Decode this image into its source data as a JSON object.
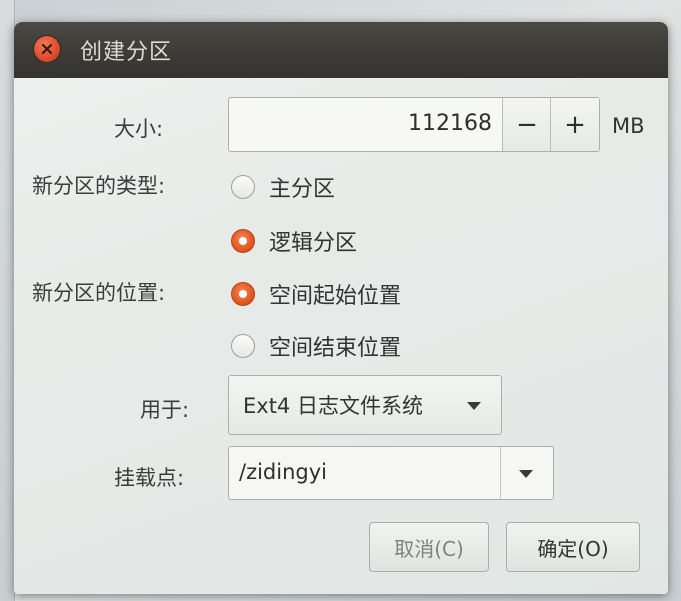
{
  "window": {
    "title": "创建分区"
  },
  "size": {
    "label": "大小:",
    "value": "112168",
    "minus": "−",
    "plus": "+",
    "unit": "MB"
  },
  "type": {
    "label": "新分区的类型:",
    "options": [
      {
        "label": "主分区",
        "selected": false
      },
      {
        "label": "逻辑分区",
        "selected": true
      }
    ]
  },
  "location": {
    "label": "新分区的位置:",
    "options": [
      {
        "label": "空间起始位置",
        "selected": true
      },
      {
        "label": "空间结束位置",
        "selected": false
      }
    ]
  },
  "use_as": {
    "label": "用于:",
    "value": "Ext4 日志文件系统"
  },
  "mount_point": {
    "label": "挂载点:",
    "value": "/zidingyi"
  },
  "buttons": {
    "cancel": "取消(C)",
    "ok": "确定(O)"
  },
  "colors": {
    "titlebar": "#3c3b37",
    "accent": "#e25c23",
    "close": "#df4b2a"
  }
}
